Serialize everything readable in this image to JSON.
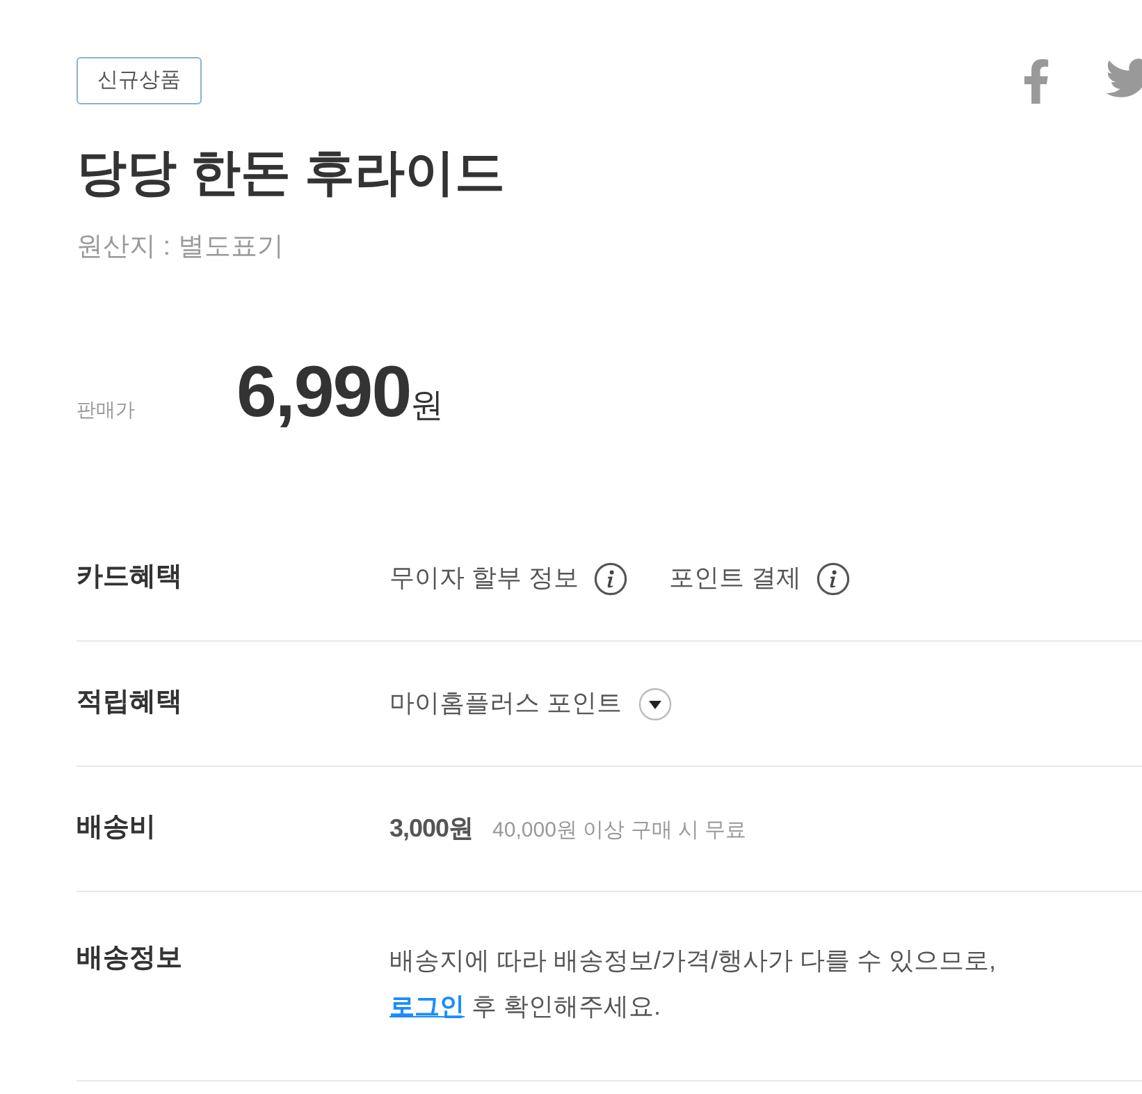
{
  "badge": {
    "label": "신규상품"
  },
  "product": {
    "title": "당당 한돈 후라이드",
    "origin": "원산지 : 별도표기"
  },
  "price": {
    "label": "판매가",
    "amount": "6,990",
    "unit": "원"
  },
  "info_rows": [
    {
      "kind": "benefits",
      "label": "카드혜택",
      "items": [
        {
          "text": "무이자 할부 정보"
        },
        {
          "text": "포인트 결제"
        }
      ]
    },
    {
      "kind": "dropdown",
      "label": "적립혜택",
      "value": "마이홈플러스 포인트",
      "expanded": false
    },
    {
      "kind": "fee",
      "label": "배송비",
      "fee": "3,000원",
      "note": "40,000원 이상 구매 시 무료"
    },
    {
      "kind": "notice",
      "label": "배송정보",
      "text": "배송지에 따라 배송정보/가격/행사가 다를 수 있으므로,",
      "link": "로그인",
      "text_after": "후 확인해주세요."
    }
  ]
}
